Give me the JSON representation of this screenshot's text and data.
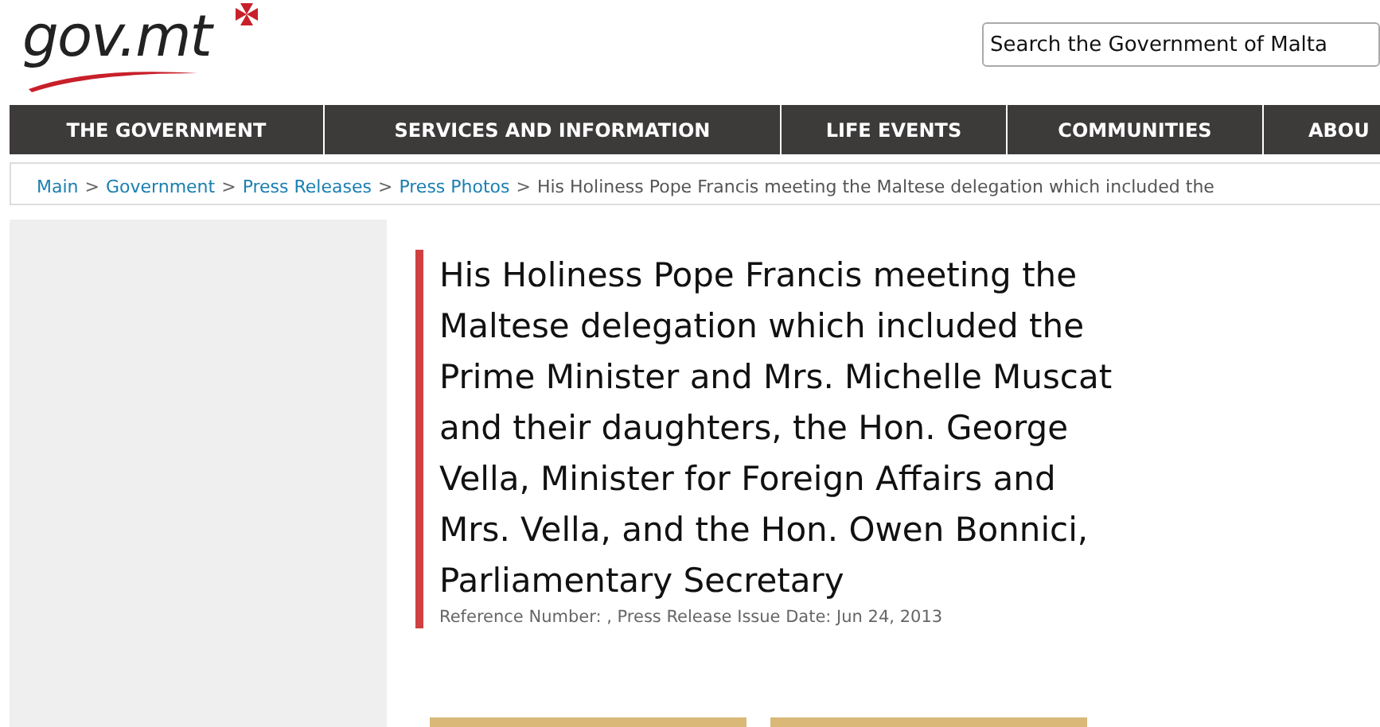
{
  "header": {
    "logo": "gov.mt",
    "search": {
      "placeholder": "Search the Government of Malta"
    }
  },
  "nav": [
    "THE GOVERNMENT",
    "SERVICES AND INFORMATION",
    "LIFE EVENTS",
    "COMMUNITIES",
    "ABOU"
  ],
  "breadcrumb": {
    "links": [
      "Main",
      "Government",
      "Press Releases",
      "Press Photos"
    ],
    "separator": ">",
    "current": "His Holiness Pope Francis meeting the Maltese delegation which included the"
  },
  "article": {
    "title": "His Holiness Pope Francis meeting the Maltese delegation which included the Prime Minister and Mrs. Michelle Muscat and their daughters, the Hon. George Vella, Minister for Foreign Affairs and Mrs. Vella, and the Hon. Owen Bonnici, Parliamentary Secretary",
    "meta": "Reference Number:  , Press Release Issue Date: Jun 24, 2013",
    "photos": [
      {
        "kind": "photo"
      },
      {
        "kind": "photo"
      }
    ]
  }
}
